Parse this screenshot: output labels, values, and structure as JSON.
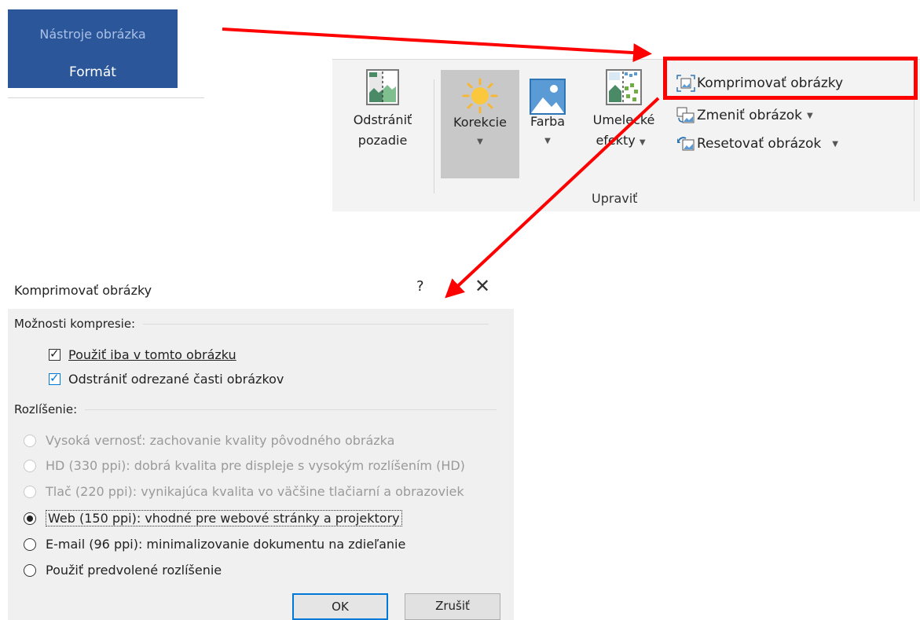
{
  "picture_tools_tab": {
    "context_label": "Nástroje obrázka",
    "tab_label": "Formát"
  },
  "ribbon": {
    "buttons": [
      {
        "label_line1": "Odstrániť",
        "label_line2": "pozadie"
      },
      {
        "label_line1": "Korekcie"
      },
      {
        "label_line1": "Farba"
      },
      {
        "label_line1": "Umelecké",
        "label_line2": "efekty"
      }
    ],
    "side_items": [
      {
        "label": "Komprimovať obrázky"
      },
      {
        "label": "Zmeniť obrázok"
      },
      {
        "label": "Resetovať obrázok"
      }
    ],
    "group_label": "Upraviť"
  },
  "dialog": {
    "title": "Komprimovať obrázky",
    "help": "?",
    "close": "✕",
    "compression_header": "Možnosti kompresie:",
    "checkboxes": [
      {
        "label": "Použiť iba v tomto obrázku",
        "checked": true
      },
      {
        "label": "Odstrániť odrezané časti obrázkov",
        "checked": true
      }
    ],
    "resolution_header": "Rozlíšenie:",
    "options": [
      {
        "label": "Vysoká vernosť: zachovanie kvality pôvodného obrázka",
        "disabled": true,
        "selected": false
      },
      {
        "label": "HD (330 ppi): dobrá kvalita pre displeje s vysokým rozlíšením (HD)",
        "disabled": true,
        "selected": false
      },
      {
        "label": "Tlač (220 ppi): vynikajúca kvalita vo väčšine tlačiarní a obrazoviek",
        "disabled": true,
        "selected": false
      },
      {
        "label": "Web (150 ppi): vhodné pre webové stránky a projektory",
        "disabled": false,
        "selected": true
      },
      {
        "label": "E-mail (96 ppi): minimalizovanie dokumentu na zdieľanie",
        "disabled": false,
        "selected": false
      },
      {
        "label": "Použiť predvolené rozlíšenie",
        "disabled": false,
        "selected": false
      }
    ],
    "ok_label": "OK",
    "cancel_label": "Zrušiť"
  },
  "colors": {
    "tab_blue": "#2b579a",
    "highlight_red": "#ff0000",
    "focus_blue": "#0078d7",
    "dialog_bg": "#f0f0f0",
    "ribbon_bg": "#f3f3f3"
  }
}
